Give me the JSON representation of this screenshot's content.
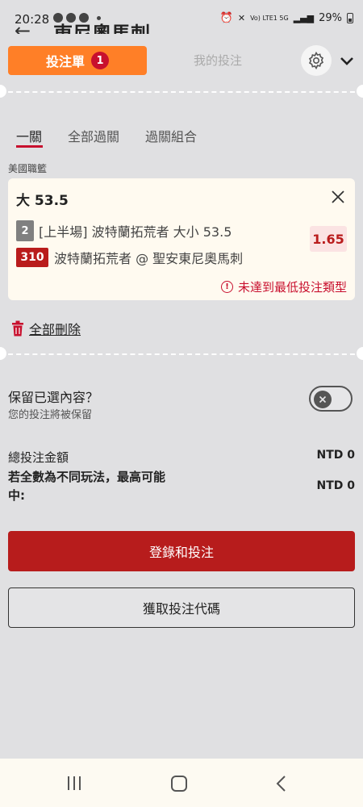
{
  "status_bar": {
    "time": "20:28",
    "network_text": "Vo) LTE1 5G",
    "battery": "29%"
  },
  "background_page": {
    "title_fragment": "東尼奧馬刺"
  },
  "header": {
    "betslip_tab": "投注單",
    "betslip_count": "1",
    "mybets_tab": "我的投注"
  },
  "subtabs": [
    "一關",
    "全部過關",
    "過關組合"
  ],
  "league": "美國職籃",
  "selection": {
    "title": "大 53.5",
    "period_number": "2",
    "market": "[上半場] 波特蘭拓荒者 大小 53.5",
    "event_code": "310",
    "match": "波特蘭拓荒者 @ 聖安東尼奧馬刺",
    "odds": "1.65",
    "warning": "未達到最低投注類型"
  },
  "delete_all": "全部刪除",
  "keep_selections": {
    "title": "保留已選內容？",
    "subtitle": "您的投注將被保留",
    "enabled": false
  },
  "totals": {
    "total_stake_label": "總投注金額",
    "total_stake_value": "NTD 0",
    "max_win_label": "若全數為不同玩法，最高可能中:",
    "max_win_value": "NTD 0"
  },
  "buttons": {
    "login_bet": "登錄和投注",
    "get_code": "獲取投注代碼"
  },
  "colors": {
    "accent_orange": "#ff7f27",
    "brand_red": "#b71c1c",
    "odds_bg": "#fbe3e3"
  }
}
